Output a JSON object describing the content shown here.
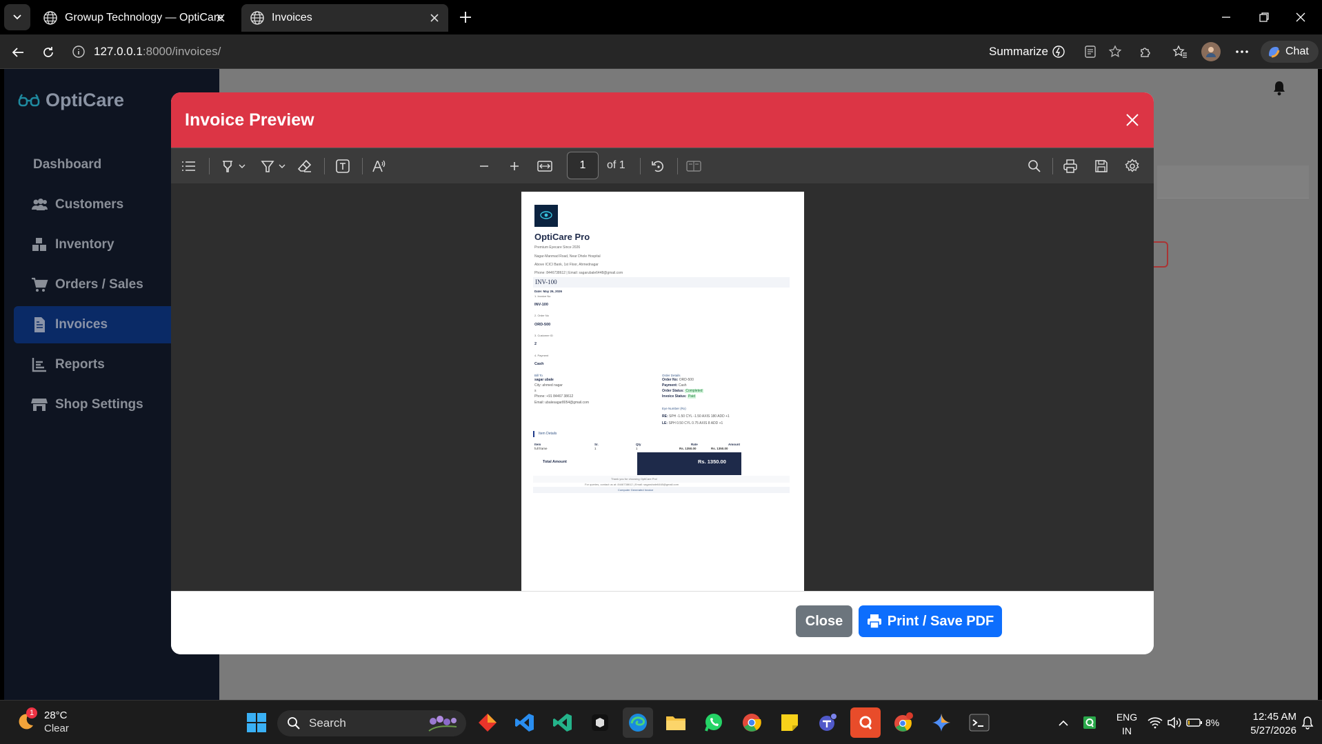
{
  "browser": {
    "tabs": [
      {
        "title": "Growup Technology — OptiCare P",
        "active": false
      },
      {
        "title": "Invoices",
        "active": true
      }
    ],
    "url_host": "127.0.0.1",
    "url_path": ":8000/invoices/",
    "summarize_label": "Summarize",
    "chat_label": "Chat"
  },
  "sidebar": {
    "brand": "OptiCare",
    "items": [
      {
        "label": "Dashboard",
        "icon": "none"
      },
      {
        "label": "Customers",
        "icon": "users-icon"
      },
      {
        "label": "Inventory",
        "icon": "boxes-icon"
      },
      {
        "label": "Orders / Sales",
        "icon": "cart-icon"
      },
      {
        "label": "Invoices",
        "icon": "file-invoice-icon",
        "active": true
      },
      {
        "label": "Reports",
        "icon": "chart-icon"
      },
      {
        "label": "Shop Settings",
        "icon": "store-icon"
      }
    ]
  },
  "modal": {
    "title": "Invoice Preview",
    "close_label": "Close",
    "print_label": "Print / Save PDF"
  },
  "pdf_toolbar": {
    "page_number": "1",
    "page_of": "of 1"
  },
  "invoice": {
    "logo_text": "OptiCare",
    "shop_name": "OptiCare Pro",
    "tagline": "Premium Eyecare Since 2026",
    "address1": "Nagar-Manmad Road, Near Dhole Hospital",
    "address2": "Above ICICI Bank, 1st Floor, Ahmednagar",
    "contact": "Phone: 8446738612 | Email: sagarubale6448@gmail.com",
    "invoice_heading": "INV-100",
    "date_line": "Date: May 26, 2026",
    "fields": [
      {
        "label": "1. Invoice No",
        "value": "INV-100"
      },
      {
        "label": "2. Order No",
        "value": "ORD-500"
      },
      {
        "label": "3. Customer ID",
        "value": "2"
      },
      {
        "label": "4. Payment",
        "value": "Cash"
      }
    ],
    "bill_to": {
      "heading": "Bill To",
      "name": "sagar ubale",
      "city": "City: ahmed nagar",
      "extra": "s",
      "phone": "Phone: +91 84467 38612",
      "email": "Email: ubalesagar8054@gmail.com"
    },
    "order_details": {
      "heading": "Order Details",
      "order_no_label": "Order No:",
      "order_no": "ORD-500",
      "payment_label": "Payment:",
      "payment": "Cash",
      "order_status_label": "Order Status:",
      "order_status": "Completed",
      "invoice_status_label": "Invoice Status:",
      "invoice_status": "Paid"
    },
    "eye": {
      "heading": "Eye Number (Rx)",
      "re_label": "RE:",
      "re": "SPH -1.50 CYL -1.50 AXIS 180 ADD +1",
      "le_label": "LE:",
      "le": "SPH 0.50 CYL 0.75 AXIS 8 ADD +1"
    },
    "items_heading": "Item Details",
    "table_headers": [
      "Item",
      "Sr.",
      "Qty",
      "Rate",
      "Amount"
    ],
    "table_rows": [
      [
        "full frame",
        "1",
        "1",
        "Rs. 1350.00",
        "Rs. 1350.00"
      ]
    ],
    "total_label": "Total Amount",
    "total_value": "Rs. 1350.00",
    "footer_thanks": "Thank you for choosing OptiCare Pro!",
    "footer_contact": "For queries, contact us at: 8446738612 | Email: sagarubale6448@gmail.com",
    "footer_note": "Computer Generated Invoice"
  },
  "taskbar": {
    "weather_temp": "28°C",
    "weather_desc": "Clear",
    "weather_badge": "1",
    "search_label": "Search",
    "lang_top": "ENG",
    "lang_bottom": "IN",
    "battery": "8%",
    "time": "12:45 AM",
    "date": "5/27/2026"
  },
  "colors": {
    "modal_header": "#dc3545",
    "print_button": "#0d6efd",
    "close_button": "#6c757d",
    "sidebar_bg": "#0e1421",
    "active_nav": "#0a2a66"
  }
}
